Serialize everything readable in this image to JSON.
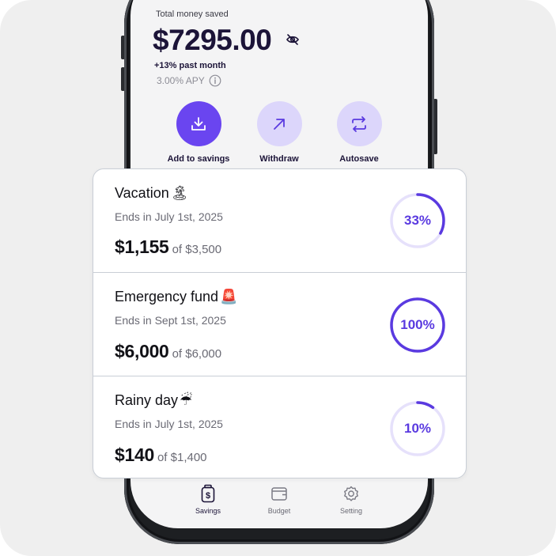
{
  "summary": {
    "total_label": "Total money saved",
    "total_amount": "$7295.00",
    "growth": "+13% past month",
    "apy": "3.00% APY"
  },
  "actions": [
    {
      "label": "Add to savings",
      "icon": "download-icon",
      "style": "primary"
    },
    {
      "label": "Withdraw",
      "icon": "arrow-up-right-icon",
      "style": "secondary"
    },
    {
      "label": "Autosave",
      "icon": "repeat-icon",
      "style": "secondary"
    }
  ],
  "goals": [
    {
      "title": "Vacation",
      "emoji": "🏝",
      "date": "Ends in July 1st, 2025",
      "saved": "$1,155",
      "target": "of $3,500",
      "percent_label": "33%",
      "progress": 0.33
    },
    {
      "title": "Emergency fund",
      "emoji": "🚨",
      "date": "Ends in Sept 1st, 2025",
      "saved": "$6,000",
      "target": "of $6,000",
      "percent_label": "100%",
      "progress": 1.0
    },
    {
      "title": "Rainy day",
      "emoji": "☔",
      "date": "Ends in July 1st, 2025",
      "saved": "$140",
      "target": "of $1,400",
      "percent_label": "10%",
      "progress": 0.1
    }
  ],
  "tabs": [
    {
      "label": "Savings",
      "icon": "savings-jar-icon",
      "active": true
    },
    {
      "label": "Budget",
      "icon": "wallet-icon",
      "active": false
    },
    {
      "label": "Setting",
      "icon": "gear-icon",
      "active": false
    }
  ],
  "colors": {
    "accent": "#6a45f0",
    "accent_soft": "#dcd6fb",
    "ring_track": "#e6e1fb",
    "ring_fill": "#5a3ae0",
    "text_dark": "#1c1438"
  }
}
